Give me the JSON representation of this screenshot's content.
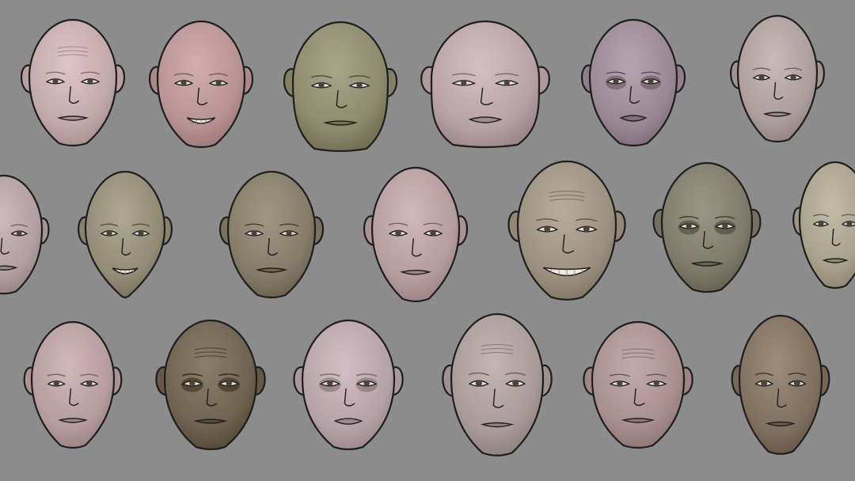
{
  "background_color": "#8c8c8c",
  "outline_color": "#1e1e1e",
  "faces": [
    {
      "row": 0,
      "skin": "#c2a9ac",
      "shape": "round",
      "expression": "neutral",
      "wrinkles": true,
      "dark_eyes": false
    },
    {
      "row": 0,
      "skin": "#b69293",
      "shape": "round",
      "expression": "teeth",
      "wrinkles": false,
      "dark_eyes": false
    },
    {
      "row": 0,
      "skin": "#8e8a6d",
      "shape": "egg",
      "expression": "neutral",
      "wrinkles": false,
      "dark_eyes": false
    },
    {
      "row": 0,
      "skin": "#b8a3a6",
      "shape": "chubby",
      "expression": "pout",
      "wrinkles": false,
      "dark_eyes": false
    },
    {
      "row": 0,
      "skin": "#9a8894",
      "shape": "round",
      "expression": "pout",
      "wrinkles": false,
      "dark_eyes": true
    },
    {
      "row": 0,
      "skin": "#ad9e9e",
      "shape": "oval",
      "expression": "neutral",
      "wrinkles": false,
      "dark_eyes": false
    },
    {
      "row": 1,
      "skin": "#b09ea0",
      "shape": "round",
      "expression": "neutral",
      "wrinkles": false,
      "dark_eyes": false
    },
    {
      "row": 1,
      "skin": "#928c76",
      "shape": "pointed",
      "expression": "teeth",
      "wrinkles": false,
      "dark_eyes": false
    },
    {
      "row": 1,
      "skin": "#857b69",
      "shape": "round",
      "expression": "neutral",
      "wrinkles": false,
      "dark_eyes": false
    },
    {
      "row": 1,
      "skin": "#b59d9f",
      "shape": "oval",
      "expression": "neutral",
      "wrinkles": false,
      "dark_eyes": false
    },
    {
      "row": 1,
      "skin": "#9c9080",
      "shape": "round",
      "expression": "grin",
      "wrinkles": true,
      "dark_eyes": false
    },
    {
      "row": 1,
      "skin": "#7f7b6b",
      "shape": "round",
      "expression": "neutral",
      "wrinkles": false,
      "dark_eyes": true
    },
    {
      "row": 1,
      "skin": "#a7a08c",
      "shape": "oval",
      "expression": "neutral",
      "wrinkles": false,
      "dark_eyes": false
    },
    {
      "row": 2,
      "skin": "#b59c9f",
      "shape": "oval",
      "expression": "neutral",
      "wrinkles": false,
      "dark_eyes": false
    },
    {
      "row": 2,
      "skin": "#6f6250",
      "shape": "round",
      "expression": "neutral",
      "wrinkles": true,
      "dark_eyes": true
    },
    {
      "row": 2,
      "skin": "#b5a3a8",
      "shape": "round",
      "expression": "pout",
      "wrinkles": false,
      "dark_eyes": true
    },
    {
      "row": 2,
      "skin": "#a99a9a",
      "shape": "round",
      "expression": "neutral",
      "wrinkles": true,
      "dark_eyes": false
    },
    {
      "row": 2,
      "skin": "#a88f8f",
      "shape": "round",
      "expression": "neutral",
      "wrinkles": true,
      "dark_eyes": false
    },
    {
      "row": 2,
      "skin": "#80705f",
      "shape": "oval",
      "expression": "neutral",
      "wrinkles": false,
      "dark_eyes": false
    }
  ]
}
